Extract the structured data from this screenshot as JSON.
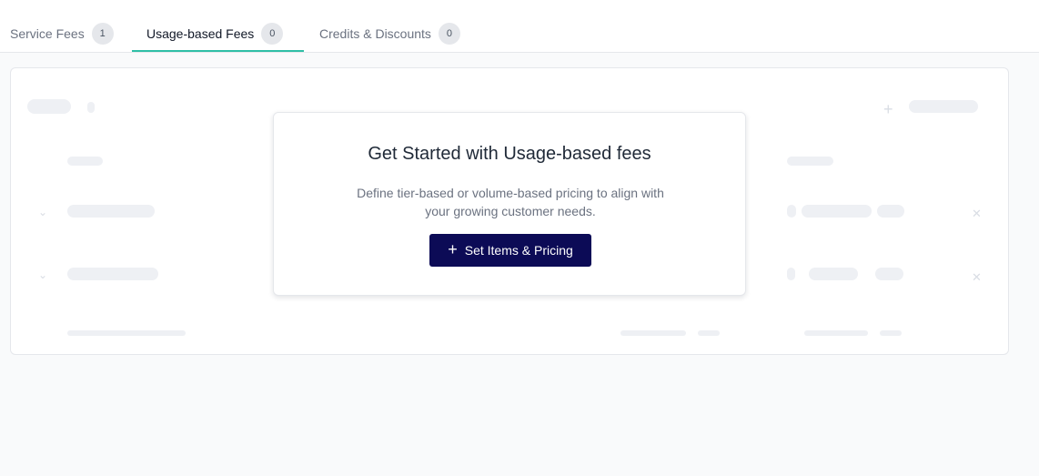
{
  "tabs": [
    {
      "label": "Service Fees",
      "count": "1",
      "active": false
    },
    {
      "label": "Usage-based Fees",
      "count": "0",
      "active": true
    },
    {
      "label": "Credits & Discounts",
      "count": "0",
      "active": false
    }
  ],
  "empty_state": {
    "title": "Get Started with Usage-based fees",
    "description": "Define tier-based or volume-based pricing to align with your growing customer needs.",
    "button_label": "Set Items & Pricing",
    "button_icon": "plus-icon"
  },
  "colors": {
    "accent_underline": "#2fbfa6",
    "primary_button": "#0c0b56",
    "skeleton": "#eef0f4"
  }
}
